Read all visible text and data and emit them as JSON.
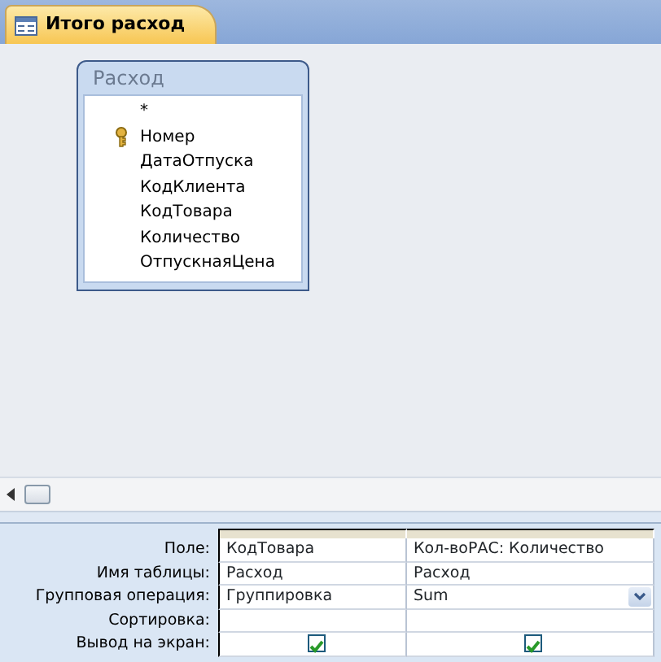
{
  "tab": {
    "title": "Итого расход",
    "selected": true
  },
  "table_box": {
    "title": "Расход",
    "fields": [
      {
        "name": "*",
        "primary_key": false
      },
      {
        "name": "Номер",
        "primary_key": true
      },
      {
        "name": "ДатаОтпуска",
        "primary_key": false
      },
      {
        "name": "КодКлиента",
        "primary_key": false
      },
      {
        "name": "КодТовара",
        "primary_key": false
      },
      {
        "name": "Количество",
        "primary_key": false
      },
      {
        "name": "ОтпускнаяЦена",
        "primary_key": false
      }
    ]
  },
  "grid": {
    "rows": [
      {
        "label": "Поле:",
        "kind": "text",
        "cells": [
          {
            "value": "КодТовара"
          },
          {
            "value": "Кол-воРАС: Количество"
          }
        ]
      },
      {
        "label": "Имя таблицы:",
        "kind": "text",
        "cells": [
          {
            "value": "Расход"
          },
          {
            "value": "Расход"
          }
        ]
      },
      {
        "label": "Групповая операция:",
        "kind": "text",
        "cells": [
          {
            "value": "Группировка",
            "dropdown": false
          },
          {
            "value": "Sum",
            "dropdown": true
          }
        ]
      },
      {
        "label": "Сортировка:",
        "kind": "text",
        "cells": [
          {},
          {}
        ]
      },
      {
        "label": "Вывод на экран:",
        "kind": "checkbox",
        "cells": [
          {
            "checked": true
          },
          {
            "checked": true
          }
        ]
      }
    ]
  }
}
